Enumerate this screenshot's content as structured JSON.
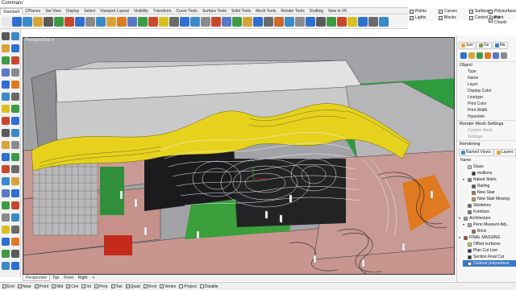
{
  "command": {
    "label": "Command:",
    "value": ""
  },
  "tabs": [
    {
      "label": "Standard",
      "active": true
    },
    {
      "label": "CPlanes"
    },
    {
      "label": "Set View"
    },
    {
      "label": "Display"
    },
    {
      "label": "Select"
    },
    {
      "label": "Viewport Layout"
    },
    {
      "label": "Visibility"
    },
    {
      "label": "Transform"
    },
    {
      "label": "Curve Tools"
    },
    {
      "label": "Surface Tools"
    },
    {
      "label": "Solid Tools"
    },
    {
      "label": "Mesh Tools"
    },
    {
      "label": "Render Tools"
    },
    {
      "label": "Drafting"
    },
    {
      "label": "New in V6"
    }
  ],
  "filters": [
    {
      "label": "Points",
      "checked": true
    },
    {
      "label": "Curves",
      "checked": true
    },
    {
      "label": "Surfaces",
      "checked": true
    },
    {
      "label": "Polysurfaces",
      "checked": true
    },
    {
      "label": "Lights",
      "checked": true
    },
    {
      "label": "Blocks",
      "checked": true
    },
    {
      "label": "Control Points",
      "checked": true
    },
    {
      "label": "Point Clouds",
      "checked": true
    }
  ],
  "viewport": {
    "title": "Perspective",
    "menu_arrow": "▾"
  },
  "viewport_tabs": [
    "Perspective",
    "Top",
    "Front",
    "Right",
    "+"
  ],
  "status_snaps": [
    {
      "label": "End",
      "checked": true
    },
    {
      "label": "Near",
      "checked": true
    },
    {
      "label": "Point",
      "checked": true
    },
    {
      "label": "Mid",
      "checked": true
    },
    {
      "label": "Cen",
      "checked": true
    },
    {
      "label": "Int",
      "checked": true
    },
    {
      "label": "Perp",
      "checked": true
    },
    {
      "label": "Tan",
      "checked": true
    },
    {
      "label": "Quad",
      "checked": true
    },
    {
      "label": "Knot",
      "checked": true
    },
    {
      "label": "Vertex",
      "checked": true
    },
    {
      "label": "Project",
      "checked": false
    },
    {
      "label": "Disable",
      "checked": false
    }
  ],
  "right_panel": {
    "top_tabs": [
      {
        "label": "Sun",
        "color": "#e8a23a"
      },
      {
        "label": "Ge",
        "color": "#7aa04a"
      },
      {
        "label": "Ma",
        "color": "#3a7cc8"
      }
    ],
    "object_section": "Object",
    "properties": [
      "Type",
      "Name",
      "Layer",
      "Display Color",
      "Linetype",
      "Print Color",
      "Print Width",
      "Hyperlink"
    ],
    "render_mesh_section": "Render Mesh Settings",
    "render_mesh_props": [
      "Custom Mesh",
      "Settings"
    ],
    "rendering_section": "Rendering",
    "bottom_tabs": [
      {
        "label": "Named Views",
        "color": "#4a86c8"
      },
      {
        "label": "Layers",
        "color": "#d8a43a"
      }
    ],
    "name_header": "Name",
    "layers": [
      {
        "label": "Glass",
        "indent": 1,
        "exp": "",
        "color": "#9fd4e8"
      },
      {
        "label": "mullions",
        "indent": 2,
        "exp": "",
        "color": "#333333"
      },
      {
        "label": "Raked Stairs",
        "indent": 1,
        "exp": "▾",
        "color": "#888888"
      },
      {
        "label": "Railing",
        "indent": 2,
        "exp": "",
        "color": "#555555"
      },
      {
        "label": "New Stair",
        "indent": 2,
        "exp": "",
        "color": "#cc6633"
      },
      {
        "label": "New Stair Missing",
        "indent": 2,
        "exp": "",
        "color": "#cc9933"
      },
      {
        "label": "Skeletons",
        "indent": 1,
        "exp": "",
        "color": "#666666"
      },
      {
        "label": "Furniture",
        "indent": 1,
        "exp": "",
        "color": "#777777"
      },
      {
        "label": "Architecture",
        "indent": 0,
        "exp": "▾",
        "color": "#999999"
      },
      {
        "label": "Penn Museum Adj...",
        "indent": 1,
        "exp": "▾",
        "color": "#aaaaaa"
      },
      {
        "label": "Brick",
        "indent": 2,
        "exp": "",
        "color": "#b85a3a"
      },
      {
        "label": "FINAL MASSING",
        "indent": 0,
        "exp": "▾",
        "color": "#cc3333"
      },
      {
        "label": "Offset surfaces",
        "indent": 1,
        "exp": "",
        "color": "#dddd33"
      },
      {
        "label": "Plan Cut Line",
        "indent": 1,
        "exp": "",
        "color": "#333333"
      },
      {
        "label": "Section Final Cut",
        "indent": 1,
        "exp": "",
        "color": "#333333"
      },
      {
        "label": "Contour polysurface",
        "indent": 1,
        "exp": "",
        "color": "#ffffff",
        "selected": true
      }
    ]
  }
}
